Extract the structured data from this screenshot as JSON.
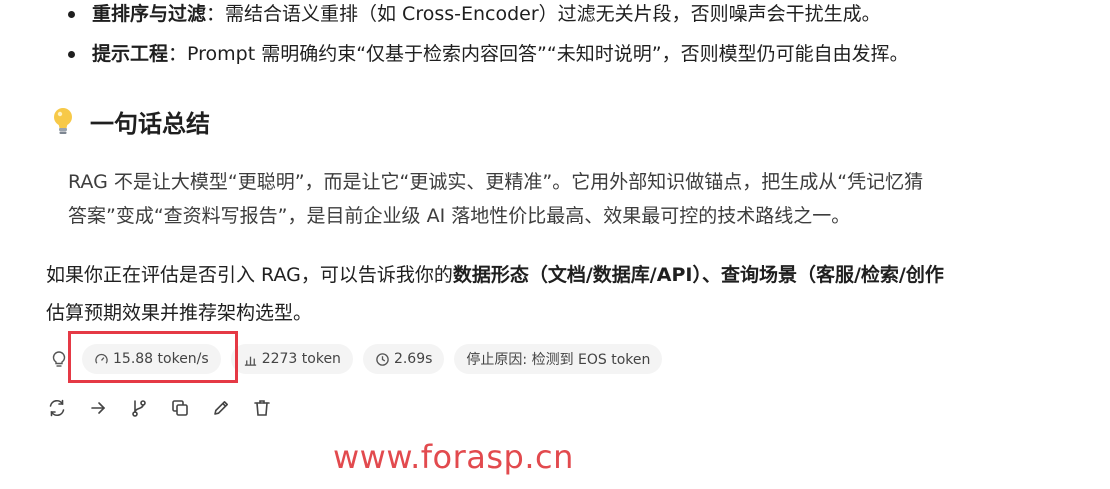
{
  "bullets": [
    {
      "bold": "重排序与过滤",
      "text": "：需结合语义重排（如 Cross-Encoder）过滤无关片段，否则噪声会干扰生成。"
    },
    {
      "bold": "提示工程",
      "text": "：Prompt 需明确约束“仅基于检索内容回答”“未知时说明”，否则模型仍可能自由发挥。"
    }
  ],
  "summary": {
    "heading": "一句话总结",
    "quote_line1": "RAG 不是让大模型“更聪明”，而是让它“更诚实、更精准”。它用外部知识做锚点，把生成从“凭记忆猜",
    "quote_line2": "答案”变成“查资料写报告”，是目前企业级 AI 落地性价比最高、效果最可控的技术路线之一。"
  },
  "closing": {
    "prefix": "如果你正在评估是否引入 RAG，可以告诉我你的",
    "bold": "数据形态（文档/数据库/API）、查询场景（客服/检索/创作",
    "line2": "估算预期效果并推荐架构选型。"
  },
  "metrics": {
    "speed": "15.88 token/s",
    "tokens": "2273 token",
    "time": "2.69s",
    "stop_reason": "停止原因: 检测到 EOS token"
  },
  "icons": {
    "heading": "lightbulb-icon",
    "metrics": "lightbulb-outline-icon",
    "speed": "gauge-icon",
    "tokens": "token-count-icon",
    "time": "clock-icon",
    "actions": [
      "regenerate-icon",
      "continue-arrow-icon",
      "branch-icon",
      "copy-icon",
      "edit-pencil-icon",
      "delete-trash-icon"
    ]
  },
  "watermark": "www.forasp.cn",
  "colors": {
    "highlight": "#e53945",
    "watermark": "#e24a4e",
    "chip_bg": "#f4f4f4"
  }
}
